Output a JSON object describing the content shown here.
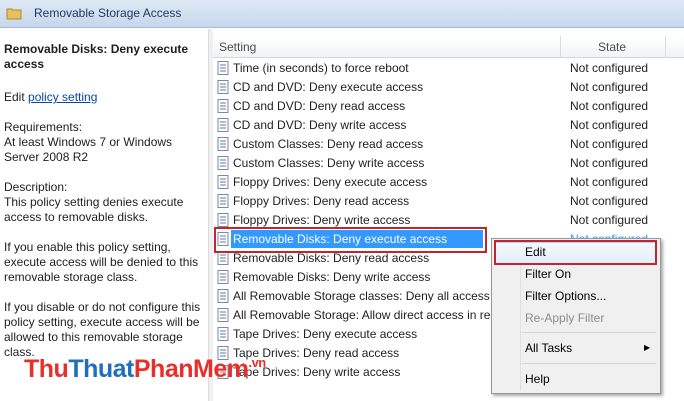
{
  "window": {
    "title": "Removable Storage Access"
  },
  "left_pane": {
    "title": "Removable Disks: Deny execute access",
    "edit_prefix": "Edit ",
    "edit_link": "policy setting",
    "requirements_label": "Requirements:",
    "requirements_text": "At least Windows 7 or Windows Server 2008 R2",
    "description_label": "Description:",
    "description_text": "This policy setting denies execute access to removable disks.",
    "para_enable": "If you enable this policy setting, execute access will be denied to this removable storage class.",
    "para_disable": "If you disable or do not configure this policy setting, execute access will be allowed to this removable storage class."
  },
  "list": {
    "columns": {
      "setting": "Setting",
      "state": "State"
    },
    "rows": [
      {
        "setting": "Time (in seconds) to force reboot",
        "state": "Not configured"
      },
      {
        "setting": "CD and DVD: Deny execute access",
        "state": "Not configured"
      },
      {
        "setting": "CD and DVD: Deny read access",
        "state": "Not configured"
      },
      {
        "setting": "CD and DVD: Deny write access",
        "state": "Not configured"
      },
      {
        "setting": "Custom Classes: Deny read access",
        "state": "Not configured"
      },
      {
        "setting": "Custom Classes: Deny write access",
        "state": "Not configured"
      },
      {
        "setting": "Floppy Drives: Deny execute access",
        "state": "Not configured"
      },
      {
        "setting": "Floppy Drives: Deny read access",
        "state": "Not configured"
      },
      {
        "setting": "Floppy Drives: Deny write access",
        "state": "Not configured"
      },
      {
        "setting": "Removable Disks: Deny execute access",
        "state": "Not configured",
        "selected": true
      },
      {
        "setting": "Removable Disks: Deny read access",
        "state": ""
      },
      {
        "setting": "Removable Disks: Deny write access",
        "state": ""
      },
      {
        "setting": "All Removable Storage classes: Deny all access",
        "state": ""
      },
      {
        "setting": "All Removable Storage: Allow direct access in rem",
        "state": ""
      },
      {
        "setting": "Tape Drives: Deny execute access",
        "state": ""
      },
      {
        "setting": "Tape Drives: Deny read access",
        "state": ""
      },
      {
        "setting": "Tape Drives: Deny write access",
        "state": ""
      }
    ]
  },
  "context_menu": {
    "edit": "Edit",
    "filter_on": "Filter On",
    "filter_options": "Filter Options...",
    "reapply_filter": "Re-Apply Filter",
    "all_tasks": "All Tasks",
    "help": "Help"
  },
  "watermark": {
    "part1": "Thu",
    "part2": "Thuat",
    "part3": "PhanMem",
    "part4": ".vn"
  },
  "colors": {
    "selection": "#3399ff",
    "highlight_box": "#c0272d",
    "link": "#0645ad"
  }
}
